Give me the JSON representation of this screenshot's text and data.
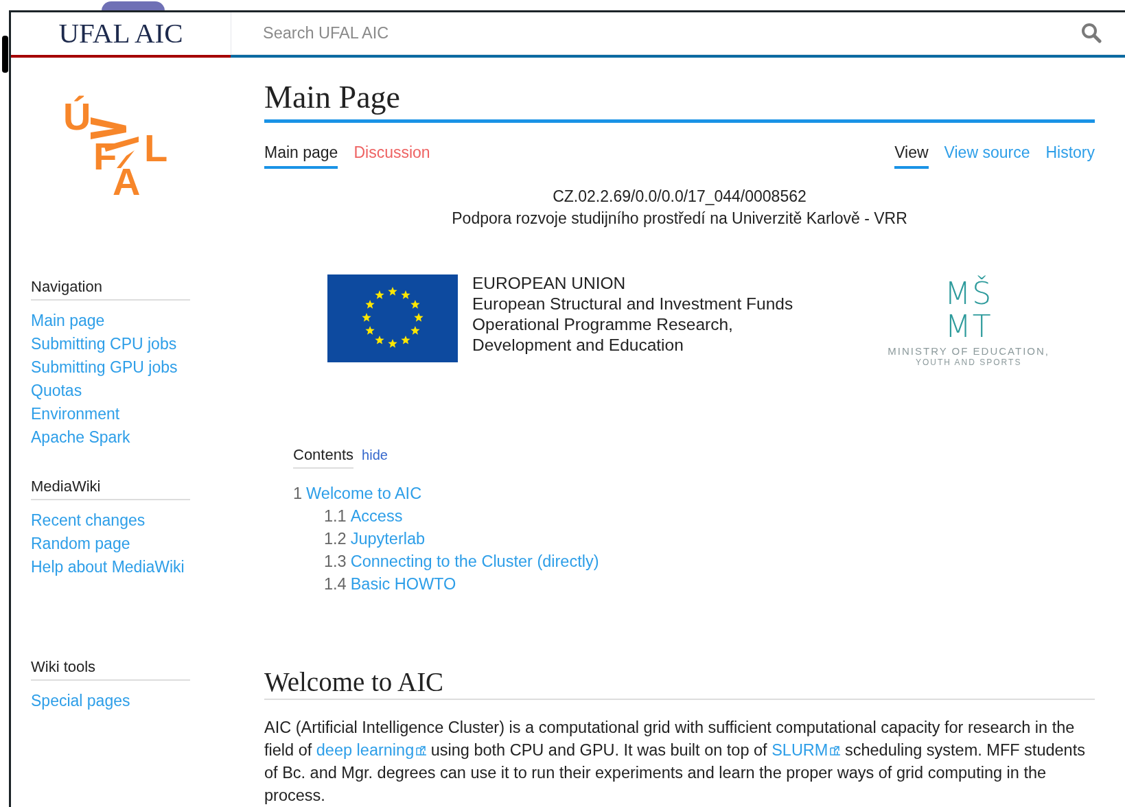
{
  "header": {
    "site_title": "UFAL AIC",
    "search": {
      "placeholder": "Search UFAL AIC"
    }
  },
  "sidebar": {
    "logo_letters": [
      "Ú",
      "F",
      "A",
      "L"
    ],
    "sections": [
      {
        "heading": "Navigation",
        "items": [
          "Main page",
          "Submitting CPU jobs",
          "Submitting GPU jobs",
          "Quotas",
          "Environment",
          "Apache Spark"
        ]
      },
      {
        "heading": "MediaWiki",
        "items": [
          "Recent changes",
          "Random page",
          "Help about MediaWiki"
        ]
      },
      {
        "heading": "Wiki tools",
        "items": [
          "Special pages"
        ]
      }
    ]
  },
  "page": {
    "title": "Main Page",
    "namespace_tabs": [
      {
        "label": "Main page",
        "selected": true,
        "exists": true
      },
      {
        "label": "Discussion",
        "selected": false,
        "exists": false
      }
    ],
    "view_tabs": [
      {
        "label": "View",
        "selected": true
      },
      {
        "label": "View source",
        "selected": false
      },
      {
        "label": "History",
        "selected": false
      }
    ]
  },
  "project": {
    "code": "CZ.02.2.69/0.0/0.0/17_044/0008562",
    "name": "Podpora rozvoje studijního prostředí na Univerzitě Karlově - VRR"
  },
  "eu_logo": {
    "lines": [
      "EUROPEAN UNION",
      "European Structural and Investment Funds",
      "Operational Programme Research,",
      "Development and Education"
    ]
  },
  "ministry_logo": {
    "mark_lines": [
      "MŠ",
      "MT"
    ],
    "caption_lines": [
      "MINISTRY OF EDUCATION,",
      "YOUTH AND SPORTS"
    ]
  },
  "toc": {
    "title": "Contents",
    "toggle": "hide",
    "items": [
      {
        "number": "1",
        "label": "Welcome to AIC",
        "children": [
          {
            "number": "1.1",
            "label": "Access"
          },
          {
            "number": "1.2",
            "label": "Jupyterlab"
          },
          {
            "number": "1.3",
            "label": "Connecting to the Cluster (directly)"
          },
          {
            "number": "1.4",
            "label": "Basic HOWTO"
          }
        ]
      }
    ]
  },
  "sections": [
    {
      "heading": "Welcome to AIC",
      "paragraph": [
        {
          "kind": "text",
          "text": "AIC (Artificial Intelligence Cluster) is a computational grid with sufficient computational capacity for research in the field of "
        },
        {
          "kind": "external_link",
          "text": "deep learning"
        },
        {
          "kind": "text",
          "text": " using both CPU and GPU. It was built on top of "
        },
        {
          "kind": "external_link",
          "text": "SLURM"
        },
        {
          "kind": "text",
          "text": " scheduling system. MFF students of Bc. and Mgr. degrees can use it to run their experiments and learn the proper ways of grid computing in the process."
        }
      ]
    }
  ]
}
